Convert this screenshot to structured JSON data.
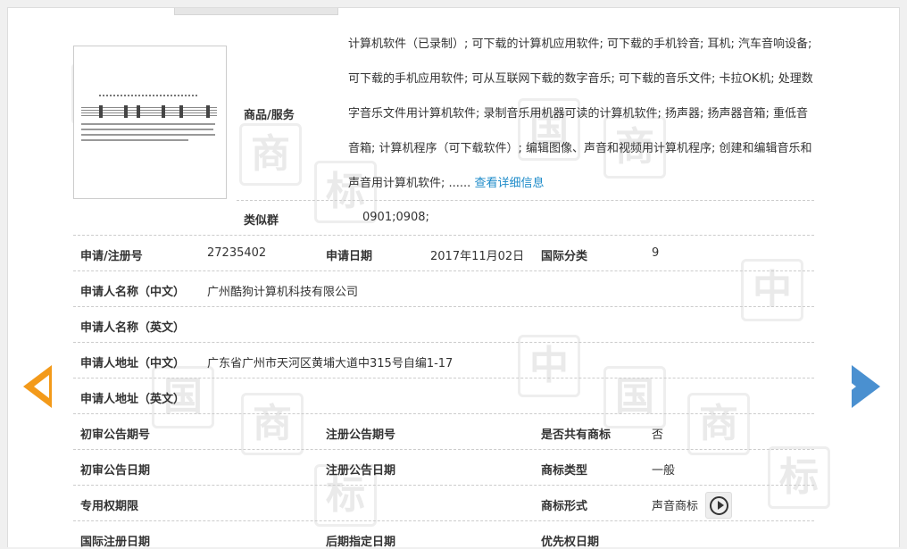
{
  "goods": {
    "label": "商品/服务",
    "text": "计算机软件（已录制）; 可下载的计算机应用软件; 可下载的手机铃音; 耳机; 汽车音响设备; 可下载的手机应用软件; 可从互联网下载的数字音乐; 可下载的音乐文件; 卡拉OK机; 处理数字音乐文件用计算机软件; 录制音乐用机器可读的计算机软件; 扬声器; 扬声器音箱; 重低音音箱; 计算机程序（可下载软件）; 编辑图像、声音和视频用计算机程序; 创建和编辑音乐和声音用计算机软件; ......",
    "more_link": "查看详细信息"
  },
  "similar_group": {
    "label": "类似群",
    "value": "0901;0908;"
  },
  "fields": {
    "reg_no": {
      "label": "申请/注册号",
      "value": "27235402"
    },
    "app_date": {
      "label": "申请日期",
      "value": "2017年11月02日"
    },
    "intl_class": {
      "label": "国际分类",
      "value": "9"
    },
    "applicant_cn": {
      "label": "申请人名称（中文）",
      "value": "广州酷狗计算机科技有限公司"
    },
    "applicant_en": {
      "label": "申请人名称（英文）",
      "value": ""
    },
    "address_cn": {
      "label": "申请人地址（中文）",
      "value": "广东省广州市天河区黄埔大道中315号自编1-17"
    },
    "address_en": {
      "label": "申请人地址（英文）",
      "value": ""
    },
    "prelim_pub_no": {
      "label": "初审公告期号",
      "value": ""
    },
    "reg_pub_no": {
      "label": "注册公告期号",
      "value": ""
    },
    "shared_mark": {
      "label": "是否共有商标",
      "value": "否"
    },
    "prelim_pub_date": {
      "label": "初审公告日期",
      "value": ""
    },
    "reg_pub_date": {
      "label": "注册公告日期",
      "value": ""
    },
    "mark_type": {
      "label": "商标类型",
      "value": "一般"
    },
    "exclusive_period": {
      "label": "专用权期限",
      "value": ""
    },
    "mark_form": {
      "label": "商标形式",
      "value": "声音商标"
    },
    "intl_reg_date": {
      "label": "国际注册日期",
      "value": ""
    },
    "later_designation_date": {
      "label": "后期指定日期",
      "value": ""
    },
    "priority_date": {
      "label": "优先权日期",
      "value": ""
    }
  },
  "watermark_chars": [
    "中",
    "国",
    "商",
    "标"
  ],
  "colors": {
    "link": "#1d8bc9",
    "prev_arrow": "#f39a1a",
    "next_arrow": "#4a90d0"
  },
  "icons": {
    "prev": "chevron-left-icon",
    "next": "chevron-right-icon",
    "play": "play-icon"
  }
}
